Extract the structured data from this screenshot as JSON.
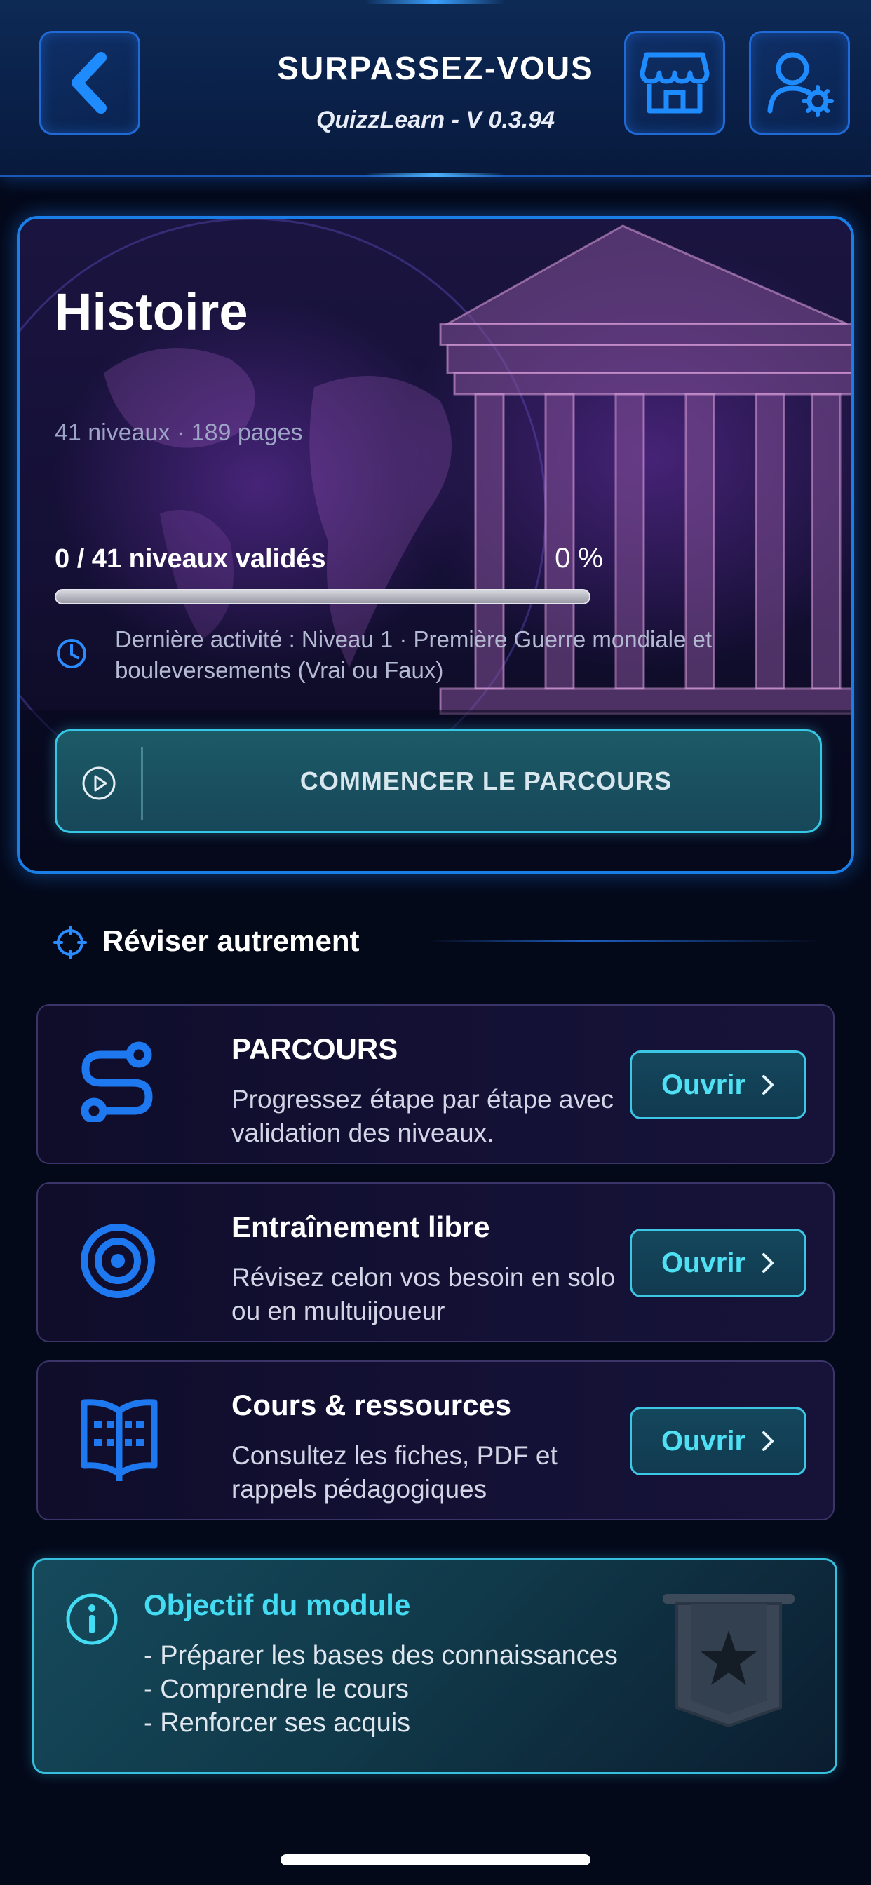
{
  "header": {
    "title": "SURPASSEZ-VOUS",
    "subtitle": "QuizzLearn - V 0.3.94"
  },
  "hero": {
    "title": "Histoire",
    "meta": "41 niveaux · 189 pages",
    "progress_label": "0 / 41 niveaux validés",
    "progress_percent_text": "0 %",
    "progress_fraction": 0,
    "last_activity": "Dernière activité : Niveau 1 · Première Guerre mondiale et bouleversements (Vrai ou Faux)",
    "start_button": "COMMENCER LE PARCOURS"
  },
  "section": {
    "title": "Réviser autrement"
  },
  "rows": [
    {
      "title": "PARCOURS",
      "description": "Progressez étape par étape avec validation des niveaux.",
      "button": "Ouvrir",
      "icon": "route-icon"
    },
    {
      "title": "Entraînement libre",
      "description": "Révisez celon vos besoin en solo ou en multuijoueur",
      "button": "Ouvrir",
      "icon": "target-icon"
    },
    {
      "title": "Cours & ressources",
      "description": "Consultez les fiches, PDF et rappels pédagogiques",
      "button": "Ouvrir",
      "icon": "open-book-icon"
    }
  ],
  "objective": {
    "title": "Objectif du module",
    "items": [
      "- Préparer les bases des connaissances",
      "- Comprendre le cours",
      "- Renforcer ses acquis"
    ]
  },
  "colors": {
    "accent_blue": "#1a7ee8",
    "accent_cyan": "#36c6e6",
    "background": "#04091a"
  }
}
